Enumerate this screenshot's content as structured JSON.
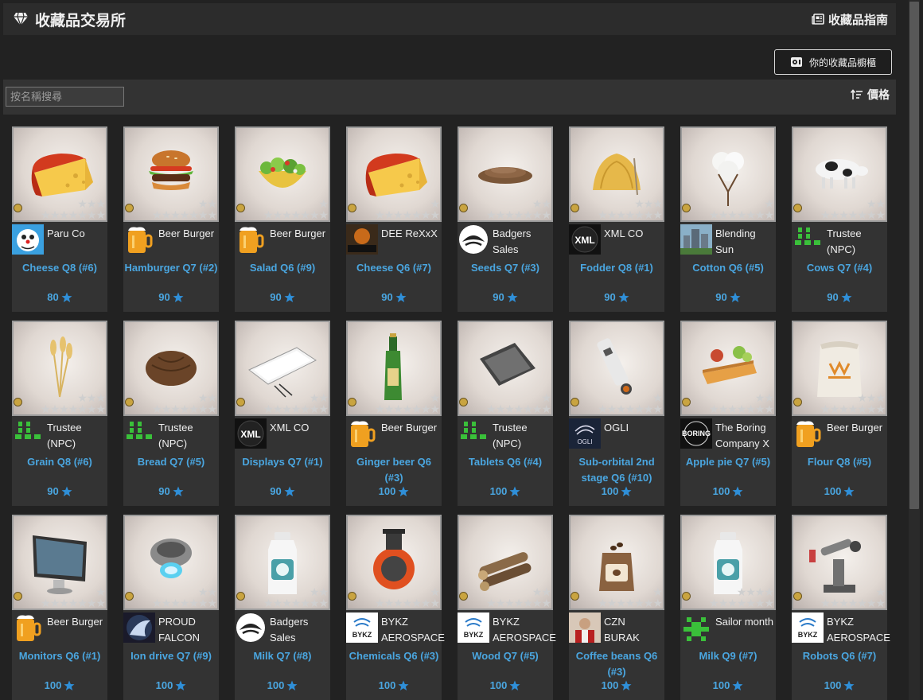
{
  "header": {
    "title": "收藏品交易所",
    "guide_label": "收藏品指南"
  },
  "cabinet_button": "你的收藏品櫥櫃",
  "search": {
    "placeholder": "按名稱搜尋",
    "value": ""
  },
  "sort": {
    "label": "價格"
  },
  "colors": {
    "accent": "#4aa6e0",
    "panel": "#333333",
    "background": "#222222"
  },
  "items": [
    {
      "name": "Cheese Q8 (#6)",
      "company": "Paru Co",
      "price": "80",
      "stars": 8,
      "art": "cheese",
      "logo": "doraemon"
    },
    {
      "name": "Hamburger Q7 (#2)",
      "company": "Beer Burger",
      "price": "90",
      "stars": 7,
      "art": "burger",
      "logo": "beer"
    },
    {
      "name": "Salad Q6 (#9)",
      "company": "Beer Burger",
      "price": "90",
      "stars": 6,
      "art": "salad",
      "logo": "beer"
    },
    {
      "name": "Cheese Q6 (#7)",
      "company": "DEE ReXxX",
      "price": "90",
      "stars": 6,
      "art": "cheese",
      "logo": "dee"
    },
    {
      "name": "Seeds Q7 (#3)",
      "company": "Badgers Sales",
      "price": "90",
      "stars": 7,
      "art": "seeds",
      "logo": "badger"
    },
    {
      "name": "Fodder Q8 (#1)",
      "company": "XML CO",
      "price": "90",
      "stars": 8,
      "art": "fodder",
      "logo": "xml"
    },
    {
      "name": "Cotton Q6 (#5)",
      "company": "Blending Sun",
      "price": "90",
      "stars": 6,
      "art": "cotton",
      "logo": "city"
    },
    {
      "name": "Cows Q7 (#4)",
      "company": "Trustee (NPC)",
      "price": "90",
      "stars": 7,
      "art": "cow",
      "logo": "trustee"
    },
    {
      "name": "Grain Q8 (#6)",
      "company": "Trustee (NPC)",
      "price": "90",
      "stars": 8,
      "art": "grain",
      "logo": "trustee"
    },
    {
      "name": "Bread Q7 (#5)",
      "company": "Trustee (NPC)",
      "price": "90",
      "stars": 7,
      "art": "bread",
      "logo": "trustee"
    },
    {
      "name": "Displays Q7 (#1)",
      "company": "XML CO",
      "price": "90",
      "stars": 7,
      "art": "display",
      "logo": "xml"
    },
    {
      "name": "Ginger beer Q6 (#3)",
      "company": "Beer Burger",
      "price": "100",
      "stars": 6,
      "art": "bottle",
      "logo": "beer"
    },
    {
      "name": "Tablets Q6 (#4)",
      "company": "Trustee (NPC)",
      "price": "100",
      "stars": 6,
      "art": "tablet",
      "logo": "trustee"
    },
    {
      "name": "Sub-orbital 2nd stage Q6 (#10)",
      "company": "OGLI",
      "price": "100",
      "stars": 6,
      "art": "rocket",
      "logo": "ogli"
    },
    {
      "name": "Apple pie Q7 (#5)",
      "company": "The Boring Company X",
      "price": "100",
      "stars": 7,
      "art": "pie",
      "logo": "boring"
    },
    {
      "name": "Flour Q8 (#5)",
      "company": "Beer Burger",
      "price": "100",
      "stars": 8,
      "art": "flour",
      "logo": "beer"
    },
    {
      "name": "Monitors Q6 (#1)",
      "company": "Beer Burger",
      "price": "100",
      "stars": 6,
      "art": "monitor",
      "logo": "beer"
    },
    {
      "name": "Ion drive Q7 (#9)",
      "company": "PROUD FALCON",
      "price": "100",
      "stars": 7,
      "art": "iondrive",
      "logo": "falcon"
    },
    {
      "name": "Milk Q7 (#8)",
      "company": "Badgers Sales",
      "price": "100",
      "stars": 7,
      "art": "milk",
      "logo": "badger"
    },
    {
      "name": "Chemicals Q6 (#3)",
      "company": "BYKZ AEROSPACE",
      "price": "100",
      "stars": 6,
      "art": "chemicals",
      "logo": "bykz"
    },
    {
      "name": "Wood Q7 (#5)",
      "company": "BYKZ AEROSPACE",
      "price": "100",
      "stars": 7,
      "art": "wood",
      "logo": "bykz"
    },
    {
      "name": "Coffee beans Q6 (#3)",
      "company": "CZN BURAK",
      "price": "100",
      "stars": 6,
      "art": "coffee",
      "logo": "czn"
    },
    {
      "name": "Milk Q9 (#7)",
      "company": "Sailor month",
      "price": "100",
      "stars": 9,
      "art": "milk",
      "logo": "sailor"
    },
    {
      "name": "Robots Q6 (#7)",
      "company": "BYKZ AEROSPACE",
      "price": "100",
      "stars": 6,
      "art": "robot",
      "logo": "bykz"
    }
  ]
}
